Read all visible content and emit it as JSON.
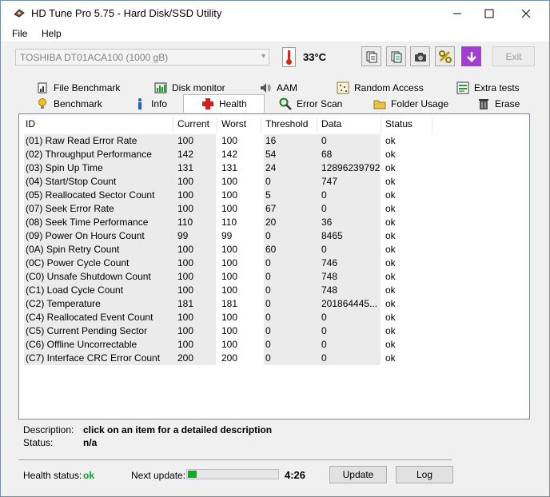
{
  "window": {
    "title": "HD Tune Pro 5.75 - Hard Disk/SSD Utility",
    "minimize": "—",
    "maximize": "☐",
    "close": "✕"
  },
  "menu": [
    "File",
    "Help"
  ],
  "toolbar": {
    "drive": "TOSHIBA DT01ACA100 (1000 gB)",
    "temperature": "33°C",
    "exit_label": "Exit",
    "buttons": [
      "copy-info-icon",
      "copy-all-icon",
      "camera-icon",
      "options-icon",
      "save-arrow-icon"
    ]
  },
  "tabs": {
    "row1": [
      "File Benchmark",
      "Disk monitor",
      "AAM",
      "Random Access",
      "Extra tests"
    ],
    "row2": [
      "Benchmark",
      "Info",
      "Health",
      "Error Scan",
      "Folder Usage",
      "Erase"
    ],
    "active": "Health"
  },
  "table": {
    "columns": [
      "ID",
      "Current",
      "Worst",
      "Threshold",
      "Data",
      "Status"
    ],
    "rows": [
      [
        "(01) Raw Read Error Rate",
        "100",
        "100",
        "16",
        "0",
        "ok"
      ],
      [
        "(02) Throughput Performance",
        "142",
        "142",
        "54",
        "68",
        "ok"
      ],
      [
        "(03) Spin Up Time",
        "131",
        "131",
        "24",
        "12896239792",
        "ok"
      ],
      [
        "(04) Start/Stop Count",
        "100",
        "100",
        "0",
        "747",
        "ok"
      ],
      [
        "(05) Reallocated Sector Count",
        "100",
        "100",
        "5",
        "0",
        "ok"
      ],
      [
        "(07) Seek Error Rate",
        "100",
        "100",
        "67",
        "0",
        "ok"
      ],
      [
        "(08) Seek Time Performance",
        "110",
        "110",
        "20",
        "36",
        "ok"
      ],
      [
        "(09) Power On Hours Count",
        "99",
        "99",
        "0",
        "8465",
        "ok"
      ],
      [
        "(0A) Spin Retry Count",
        "100",
        "100",
        "60",
        "0",
        "ok"
      ],
      [
        "(0C) Power Cycle Count",
        "100",
        "100",
        "0",
        "746",
        "ok"
      ],
      [
        "(C0) Unsafe Shutdown Count",
        "100",
        "100",
        "0",
        "748",
        "ok"
      ],
      [
        "(C1) Load Cycle Count",
        "100",
        "100",
        "0",
        "748",
        "ok"
      ],
      [
        "(C2) Temperature",
        "181",
        "181",
        "0",
        "201864445...",
        "ok"
      ],
      [
        "(C4) Reallocated Event Count",
        "100",
        "100",
        "0",
        "0",
        "ok"
      ],
      [
        "(C5) Current Pending Sector",
        "100",
        "100",
        "0",
        "0",
        "ok"
      ],
      [
        "(C6) Offline Uncorrectable",
        "100",
        "100",
        "0",
        "0",
        "ok"
      ],
      [
        "(C7) Interface CRC Error Count",
        "200",
        "200",
        "0",
        "0",
        "ok"
      ]
    ]
  },
  "details": {
    "description_label": "Description:",
    "description_value": "click on an item for a detailed description",
    "status_label": "Status:",
    "status_value": "n/a"
  },
  "footer": {
    "health_label": "Health status:",
    "health_value": "ok",
    "next_update_label": "Next update:",
    "progress_fraction": 0.1,
    "countdown": "4:26",
    "update_label": "Update",
    "log_label": "Log"
  },
  "colors": {
    "health_ok": "#06a01f",
    "progress": "#06b025",
    "row_shade": "#ebebeb"
  }
}
